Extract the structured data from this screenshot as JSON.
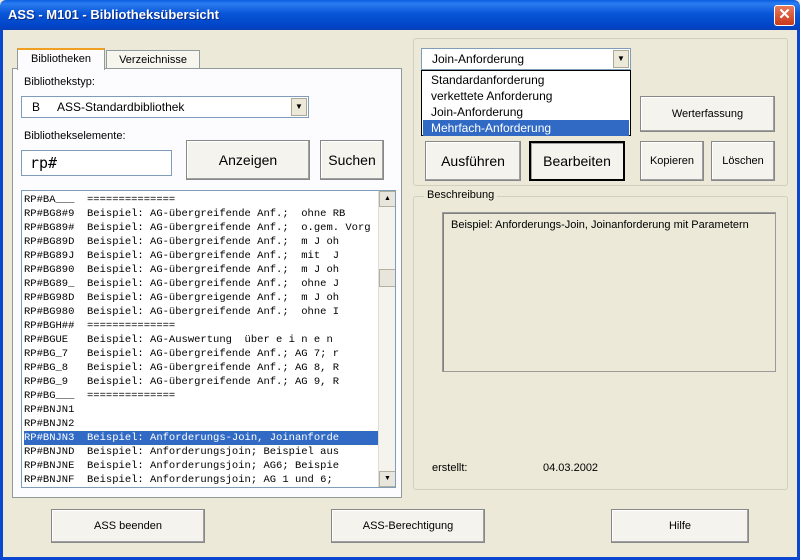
{
  "window": {
    "title": "ASS - M101 - Bibliotheksübersicht"
  },
  "tabs": [
    {
      "label": "Bibliotheken"
    },
    {
      "label": "Verzeichnisse"
    }
  ],
  "library_type": {
    "label": "Bibliothekstyp:",
    "code": "B",
    "value": "ASS-Standardbibliothek"
  },
  "elements": {
    "label": "Bibliothekselemente:",
    "input_value": "rp#"
  },
  "buttons": {
    "show": "Anzeigen",
    "search": "Suchen",
    "execute": "Ausführen",
    "edit": "Bearbeiten",
    "copy": "Kopieren",
    "delete": "Löschen",
    "value_entry": "Werterfassung",
    "exit": "ASS beenden",
    "permission": "ASS-Berechtigung",
    "help": "Hilfe"
  },
  "list": [
    "RP#BA___  ==============",
    "RP#BG8#9  Beispiel: AG-übergreifende Anf.;  ohne RB",
    "RP#BG89#  Beispiel: AG-übergreifende Anf.;  o.gem. Vorg",
    "RP#BG89D  Beispiel: AG-übergreifende Anf.;  m J oh",
    "RP#BG89J  Beispiel: AG-übergreifende Anf.;  mit  J",
    "RP#BG890  Beispiel: AG-übergreifende Anf.;  m J oh",
    "RP#BG89_  Beispiel: AG-übergreifende Anf.;  ohne J",
    "RP#BG98D  Beispiel: AG-übergreigende Anf.;  m J oh",
    "RP#BG980  Beispiel: AG-übergreifende Anf.;  ohne I",
    "RP#BGH##  ==============",
    "RP#BGUE   Beispiel: AG-Auswertung  über e i n e n",
    "RP#BG_7   Beispiel: AG-übergreifende Anf.; AG 7; r",
    "RP#BG_8   Beispiel: AG-übergreifende Anf.; AG 8, R",
    "RP#BG_9   Beispiel: AG-übergreifende Anf.; AG 9, R",
    "RP#BG___  ==============",
    "RP#BNJN1",
    "RP#BNJN2",
    "RP#BNJN3  Beispiel: Anforderungs-Join, Joinanforde",
    "RP#BNJND  Beispiel: Anforderungsjoin; Beispiel aus",
    "RP#BNJNE  Beispiel: Anforderungsjoin; AG6; Beispie",
    "RP#BNJNF  Beispiel: Anforderungsjoin; AG 1 und 6;"
  ],
  "selected_row": 17,
  "request_type": {
    "value": "Join-Anforderung",
    "options": [
      "Standardanforderung",
      "verkettete Anforderung",
      "Join-Anforderung",
      "Mehrfach-Anforderung"
    ],
    "highlighted": 3
  },
  "description": {
    "group_title": "Beschreibung",
    "text": "Beispiel: Anforderungs-Join, Joinanforderung mit Parametern",
    "created_label": "erstellt:",
    "created_value": "04.03.2002"
  },
  "colors": {
    "selection": "#316ac5",
    "titlebar": "#0a5fe0",
    "window_bg": "#ece9d8"
  }
}
